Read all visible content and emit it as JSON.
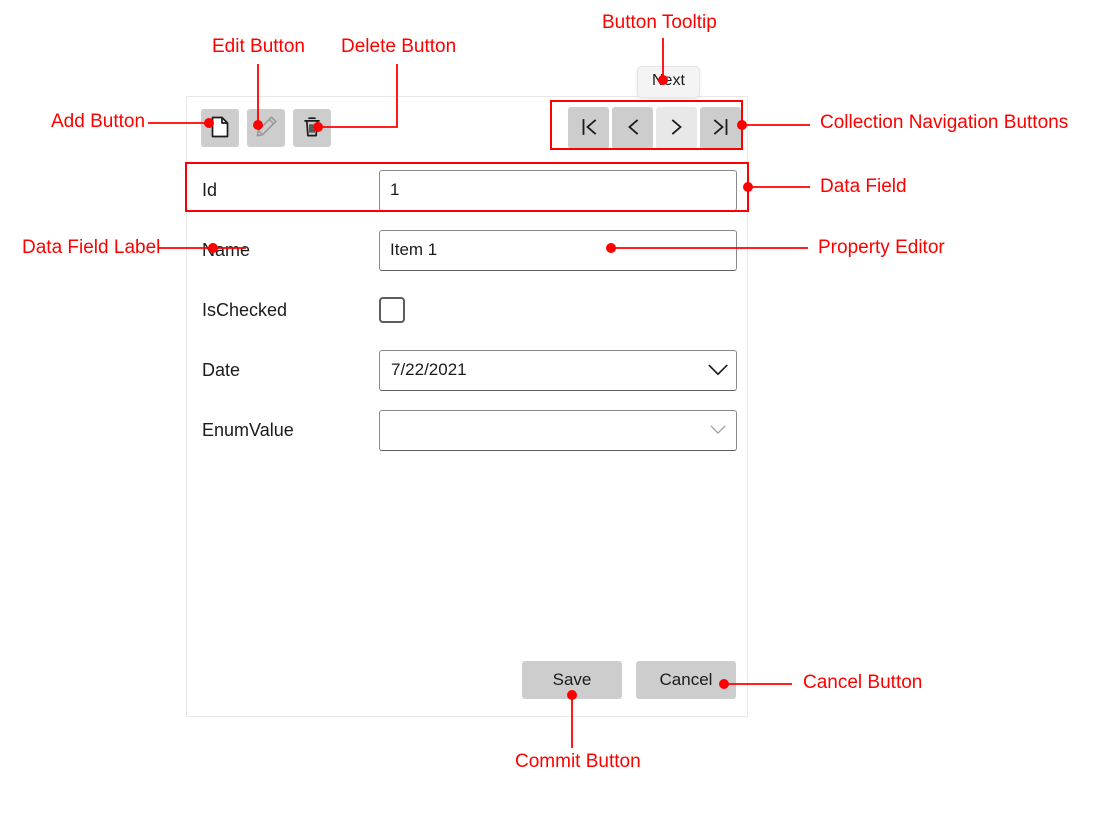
{
  "toolbar": {
    "buttons": [
      {
        "name": "add",
        "icon": "new-document-icon",
        "enabled": true
      },
      {
        "name": "edit",
        "icon": "pencil-icon",
        "enabled": false
      },
      {
        "name": "delete",
        "icon": "trash-icon",
        "enabled": true
      }
    ],
    "navigation": [
      {
        "name": "first",
        "icon": "first-page-icon",
        "glyph": "|<",
        "hovered": false
      },
      {
        "name": "previous",
        "icon": "previous-page-icon",
        "glyph": "<",
        "hovered": false
      },
      {
        "name": "next",
        "icon": "next-page-icon",
        "glyph": ">",
        "hovered": true
      },
      {
        "name": "last",
        "icon": "last-page-icon",
        "glyph": ">|",
        "hovered": false
      }
    ]
  },
  "tooltip": {
    "text": "Next"
  },
  "form": {
    "fields": [
      {
        "label": "Id",
        "editor": "textbox",
        "value": "1"
      },
      {
        "label": "Name",
        "editor": "textbox",
        "value": "Item 1"
      },
      {
        "label": "IsChecked",
        "editor": "checkbox",
        "value": "",
        "checked": false
      },
      {
        "label": "Date",
        "editor": "combobox",
        "value": "7/22/2021"
      },
      {
        "label": "EnumValue",
        "editor": "combobox",
        "value": ""
      }
    ]
  },
  "commands": {
    "save_label": "Save",
    "cancel_label": "Cancel"
  },
  "annotations": {
    "color": "#ff0000",
    "items": [
      {
        "id": "add-button",
        "text": "Add Button"
      },
      {
        "id": "edit-button",
        "text": "Edit Button"
      },
      {
        "id": "delete-button",
        "text": "Delete Button"
      },
      {
        "id": "button-tooltip",
        "text": "Button Tooltip"
      },
      {
        "id": "collection-nav",
        "text": "Collection Navigation Buttons"
      },
      {
        "id": "data-field",
        "text": "Data Field"
      },
      {
        "id": "data-field-label",
        "text": "Data Field Label"
      },
      {
        "id": "property-editor",
        "text": "Property Editor"
      },
      {
        "id": "cancel-button",
        "text": "Cancel Button"
      },
      {
        "id": "commit-button",
        "text": "Commit Button"
      }
    ]
  }
}
